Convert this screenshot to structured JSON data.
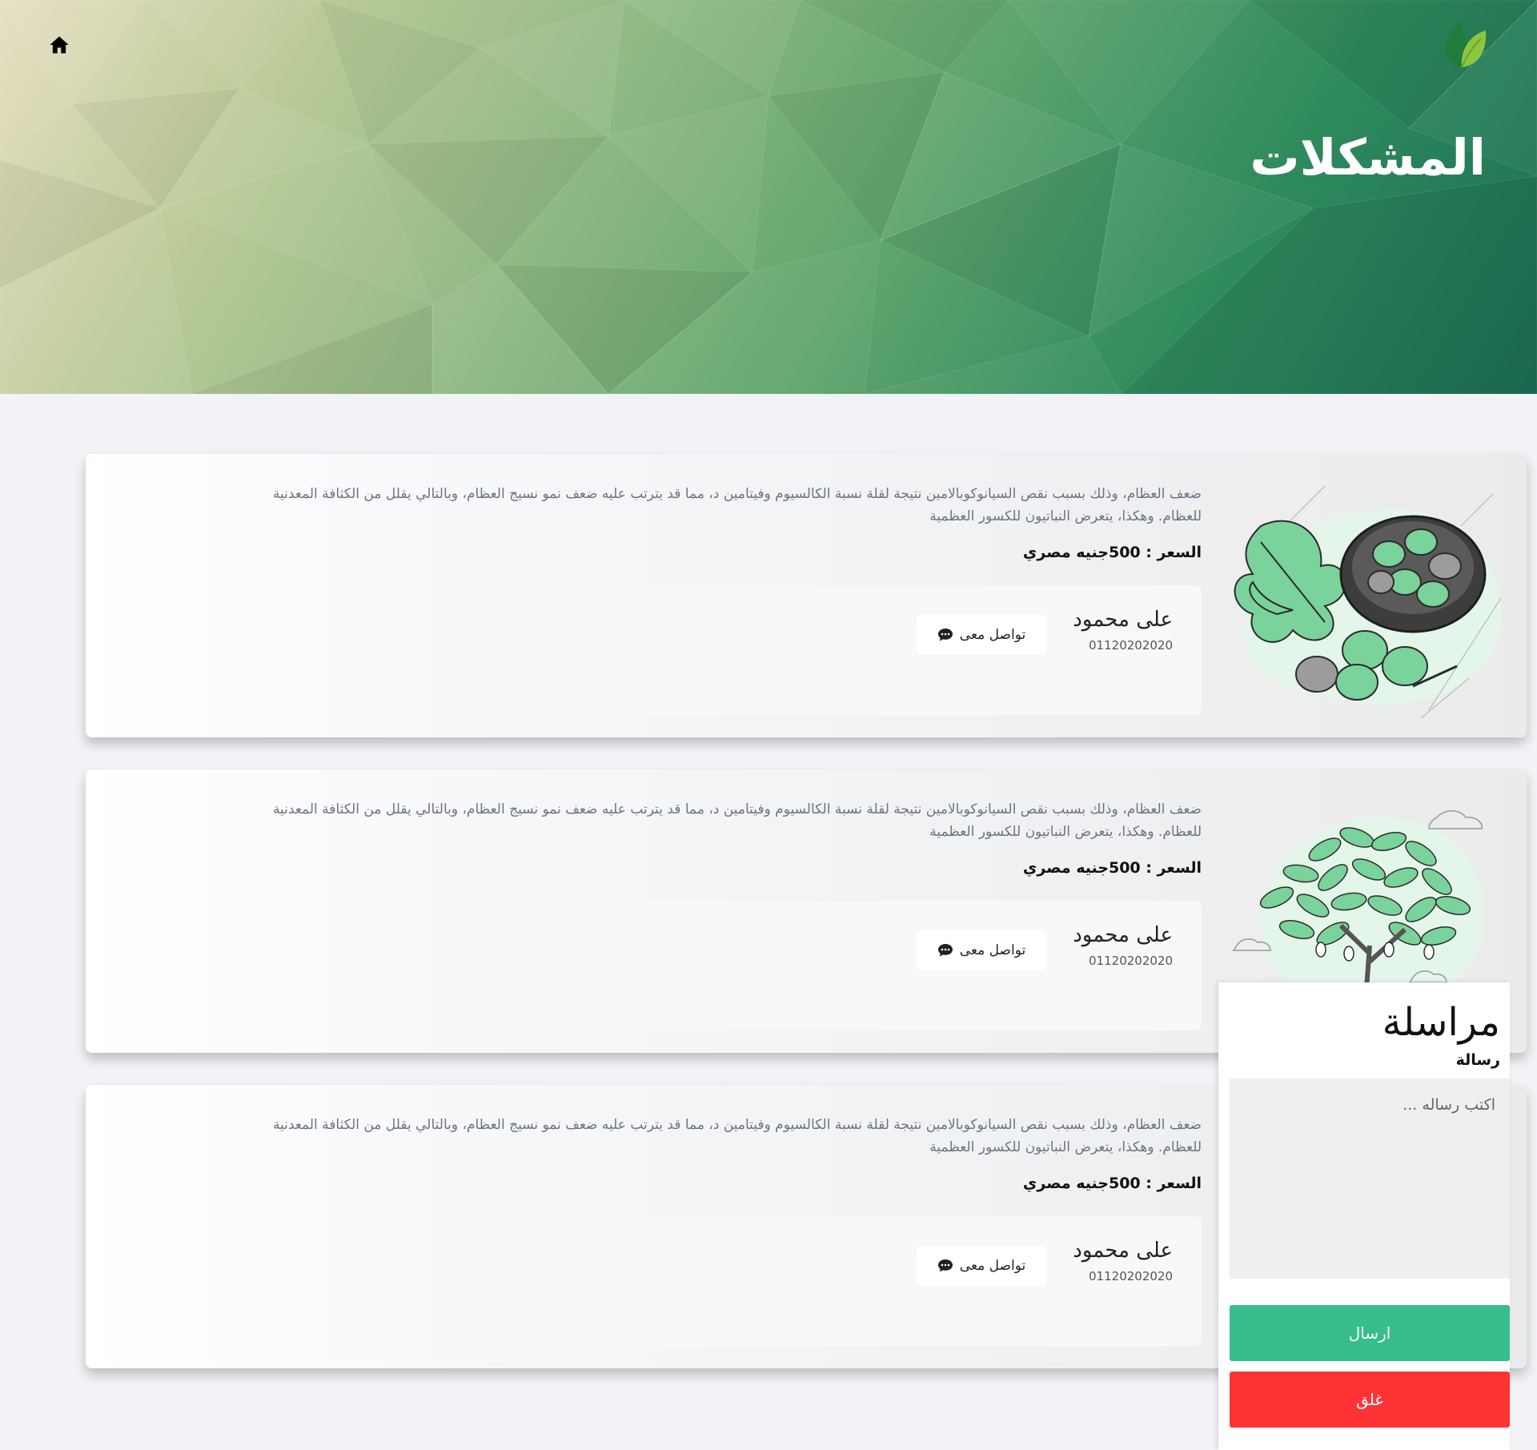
{
  "header": {
    "title": "المشكلات",
    "home_icon": "home-icon",
    "logo_icon": "leaf-logo-icon"
  },
  "listings": [
    {
      "image": "acorn-bowl-illustration",
      "description": "ضعف العظام، وذلك بسبب نقص السيانوكوبالامين نتيجة لقلة نسبة الكالسيوم وفيتامين د، مما قد يترتب عليه ضعف نمو نسيج العظام، وبالتالي يقلل من الكثافة المعدنية للعظام. وهكذا، يتعرض النباتيون للكسور العظمية",
      "price": "السعر : 500جنيه مصري",
      "seller_name": "على محمود",
      "seller_phone": "01120202020",
      "contact_label": "تواصل معى",
      "contact_icon": "chat-bubble-icon"
    },
    {
      "image": "mango-tree-illustration",
      "description": "ضعف العظام، وذلك بسبب نقص السيانوكوبالامين نتيجة لقلة نسبة الكالسيوم وفيتامين د، مما قد يترتب عليه ضعف نمو نسيج العظام، وبالتالي يقلل من الكثافة المعدنية للعظام. وهكذا، يتعرض النباتيون للكسور العظمية",
      "price": "السعر : 500جنيه مصري",
      "seller_name": "على محمود",
      "seller_phone": "01120202020",
      "contact_label": "تواصل معى",
      "contact_icon": "chat-bubble-icon"
    },
    {
      "image": "",
      "description": "ضعف العظام، وذلك بسبب نقص السيانوكوبالامين نتيجة لقلة نسبة الكالسيوم وفيتامين د، مما قد يترتب عليه ضعف نمو نسيج العظام، وبالتالي يقلل من الكثافة المعدنية للعظام. وهكذا، يتعرض النباتيون للكسور العظمية",
      "price": "السعر : 500جنيه مصري",
      "seller_name": "على محمود",
      "seller_phone": "01120202020",
      "contact_label": "تواصل معى",
      "contact_icon": "chat-bubble-icon"
    }
  ],
  "message_panel": {
    "title": "مراسلة",
    "label": "رسالة",
    "placeholder": "اكتب رساله ...",
    "send_label": "ارسال",
    "close_label": "غلق"
  },
  "colors": {
    "accent_green": "#36bd8b",
    "danger_red": "#ff3236",
    "page_background": "#f1f3f6"
  }
}
